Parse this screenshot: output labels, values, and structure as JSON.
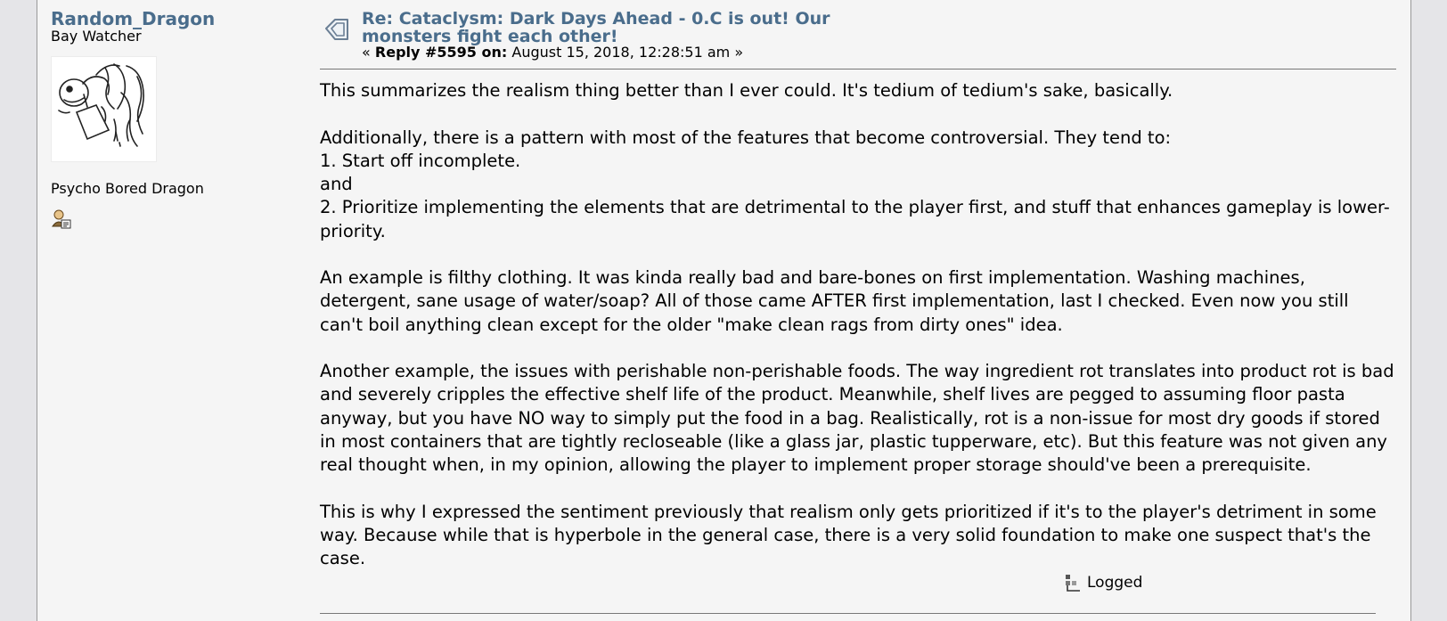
{
  "poster": {
    "name": "Random_Dragon",
    "group": "Bay Watcher",
    "title": "Psycho Bored Dragon",
    "avatar_icon": "dragon-sketch-avatar",
    "profile_icon": "profile-user-icon"
  },
  "post": {
    "subject": "Re: Cataclysm: Dark Days Ahead - 0.C is out! Our monsters fight each other!",
    "reply_prefix": "«",
    "reply_label": "Reply #5595 on:",
    "reply_date": "August 15, 2018, 12:28:51 am",
    "reply_suffix": "»",
    "body": [
      "This summarizes the realism thing better than I ever could. It's tedium of tedium's sake, basically.",
      "",
      "Additionally, there is a pattern with most of the features that become controversial. They tend to:",
      "1. Start off incomplete.",
      "and",
      "2. Prioritize implementing the elements that are detrimental to the player first, and stuff that enhances gameplay is lower-priority.",
      "",
      "An example is filthy clothing. It was kinda really bad and bare-bones on first implementation. Washing machines, detergent, sane usage of water/soap? All of those came AFTER first implementation, last I checked. Even now you still can't boil anything clean except for the older \"make clean rags from dirty ones\" idea.",
      "",
      "Another example, the issues with perishable non-perishable foods. The way ingredient rot translates into product rot is bad and severely cripples the effective shelf life of the product. Meanwhile, shelf lives are pegged to assuming floor pasta anyway, but you have NO way to simply put the food in a bag. Realistically, rot is a non-issue for most dry goods if stored in most containers that are tightly recloseable (like a glass jar, plastic tupperware, etc). But this feature was not given any real thought when, in my opinion, allowing the player to implement proper storage should've been a prerequisite.",
      "",
      "This is why I expressed the sentiment previously that realism only gets prioritized if it's to the player's detriment in some way. Because while that is hyperbole in the general case, there is a very solid foundation to make one suspect that's the case."
    ],
    "logged_label": "Logged",
    "logged_icon": "ip-logged-icon",
    "topic_icon": "xx-topic-icon"
  },
  "colors": {
    "link": "#4a6d8c",
    "page_bg": "#f5f5f5",
    "outer_bg": "#e5e5e8"
  }
}
